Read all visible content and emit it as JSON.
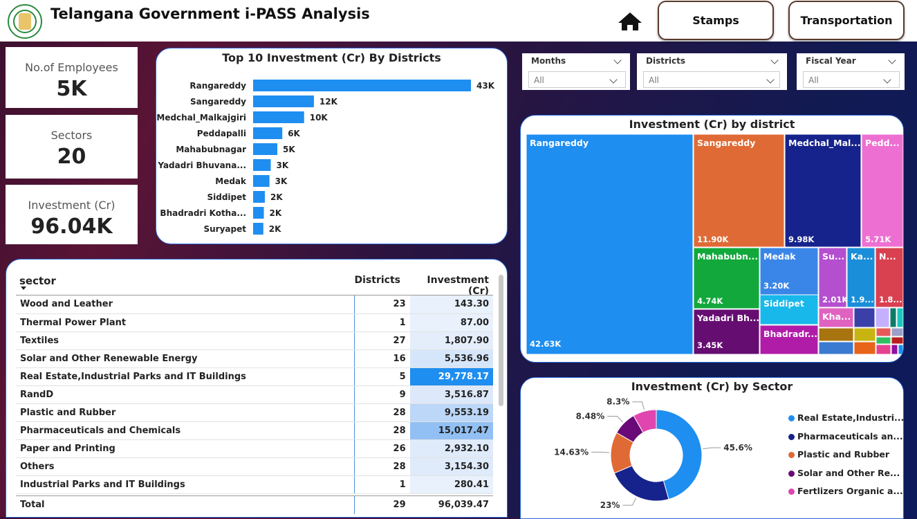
{
  "header": {
    "title": "Telangana Government i-PASS Analysis",
    "nav": [
      "Stamps",
      "Transportation"
    ]
  },
  "kpis": [
    {
      "label": "No.of Employees",
      "value": "5K"
    },
    {
      "label": "Sectors",
      "value": "20"
    },
    {
      "label": "Investment (Cr)",
      "value": "96.04K"
    }
  ],
  "slicers": [
    {
      "label": "Months",
      "value": "All"
    },
    {
      "label": "Districts",
      "value": "All"
    },
    {
      "label": "Fiscal Year",
      "value": "All"
    }
  ],
  "bar_chart": {
    "title": "Top 10 Investment (Cr) By Districts",
    "bar_color": "#1e8ef0",
    "items": [
      {
        "name": "Rangareddy",
        "value": 42630,
        "label": "43K"
      },
      {
        "name": "Sangareddy",
        "value": 11900,
        "label": "12K"
      },
      {
        "name": "Medchal_Malkajgiri",
        "value": 9980,
        "label": "10K"
      },
      {
        "name": "Peddapalli",
        "value": 5710,
        "label": "6K"
      },
      {
        "name": "Mahabubnagar",
        "value": 4740,
        "label": "5K"
      },
      {
        "name": "Yadadri Bhuvana...",
        "value": 3450,
        "label": "3K"
      },
      {
        "name": "Medak",
        "value": 3200,
        "label": "3K"
      },
      {
        "name": "Siddipet",
        "value": 2300,
        "label": "2K"
      },
      {
        "name": "Bhadradri Kotha...",
        "value": 2100,
        "label": "2K"
      },
      {
        "name": "Suryapet",
        "value": 2000,
        "label": "2K"
      }
    ]
  },
  "sector_table": {
    "columns": [
      "sector",
      "Districts",
      "Investment (Cr)"
    ],
    "rows": [
      {
        "sector": "Wood and Leather",
        "districts": "23",
        "investment": "143.30",
        "shade": "#e8f1fc"
      },
      {
        "sector": "Thermal Power Plant",
        "districts": "1",
        "investment": "87.00",
        "shade": "#e8f1fc"
      },
      {
        "sector": "Textiles",
        "districts": "27",
        "investment": "1,807.90",
        "shade": "#e4eefb"
      },
      {
        "sector": "Solar and Other Renewable Energy",
        "districts": "16",
        "investment": "5,536.96",
        "shade": "#d6e6fa"
      },
      {
        "sector": "Real Estate,Industrial Parks and IT Buildings",
        "districts": "5",
        "investment": "29,778.17",
        "shade": "#1e8ef0"
      },
      {
        "sector": "RandD",
        "districts": "9",
        "investment": "3,516.87",
        "shade": "#dde9fa"
      },
      {
        "sector": "Plastic and Rubber",
        "districts": "28",
        "investment": "9,553.19",
        "shade": "#bcd7f7"
      },
      {
        "sector": "Pharmaceuticals and Chemicals",
        "districts": "28",
        "investment": "15,017.47",
        "shade": "#92c0f4"
      },
      {
        "sector": "Paper and Printing",
        "districts": "26",
        "investment": "2,932.10",
        "shade": "#dfebfb"
      },
      {
        "sector": "Others",
        "districts": "28",
        "investment": "3,154.30",
        "shade": "#dfebfb"
      },
      {
        "sector": "Industrial Parks and IT Buildings",
        "districts": "1",
        "investment": "280.41",
        "shade": "#e8f1fc"
      }
    ],
    "total": {
      "label": "Total",
      "districts": "29",
      "investment": "96,039.47"
    }
  },
  "treemap": {
    "title": "Investment (Cr) by district",
    "tiles": [
      {
        "name": "Rangareddy",
        "value": "42.63K",
        "color": "#1e8ef0"
      },
      {
        "name": "Sangareddy",
        "value": "11.90K",
        "color": "#e06a35"
      },
      {
        "name": "Medchal_Mal...",
        "value": "9.98K",
        "color": "#16238c"
      },
      {
        "name": "Pedd...",
        "value": "5.71K",
        "color": "#ee6fd2"
      },
      {
        "name": "Mahabubn...",
        "value": "4.74K",
        "color": "#12a83c"
      },
      {
        "name": "Medak",
        "value": "3.20K",
        "color": "#3a86e8"
      },
      {
        "name": "Yadadri Bh...",
        "value": "3.45K",
        "color": "#660d72"
      },
      {
        "name": "Siddipet",
        "value": "",
        "color": "#18b8ea"
      },
      {
        "name": "Bhadradr...",
        "value": "",
        "color": "#b01ca8"
      },
      {
        "name": "Su...",
        "value": "2.01K",
        "color": "#b44fcf"
      },
      {
        "name": "Ka...",
        "value": "1.9...",
        "color": "#1a8ed8"
      },
      {
        "name": "N...",
        "value": "1.8...",
        "color": "#d94050"
      },
      {
        "name": "Kha...",
        "value": "",
        "color": "#e062c0"
      }
    ]
  },
  "donut": {
    "title": "Investment (Cr) by Sector",
    "slices": [
      {
        "name": "Real Estate,Industri...",
        "percent": 45.6,
        "label": "45.6%",
        "color": "#1e8ef0"
      },
      {
        "name": "Pharmaceuticals an...",
        "percent": 23,
        "label": "23%",
        "color": "#16238c"
      },
      {
        "name": "Plastic and Rubber",
        "percent": 14.63,
        "label": "14.63%",
        "color": "#e06a35"
      },
      {
        "name": "Solar and Other Re...",
        "percent": 8.48,
        "label": "8.48%",
        "color": "#6a0a78"
      },
      {
        "name": "Fertlizers Organic a...",
        "percent": 8.3,
        "label": "8.3%",
        "color": "#e045b0"
      }
    ]
  }
}
